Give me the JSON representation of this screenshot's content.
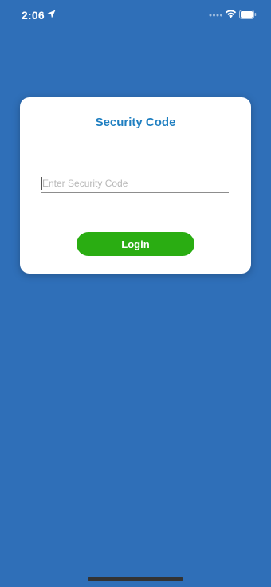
{
  "status_bar": {
    "time": "2:06"
  },
  "card": {
    "title": "Security Code",
    "input": {
      "value": "",
      "placeholder": "Enter Security Code"
    },
    "login_label": "Login"
  },
  "colors": {
    "background": "#2f6fb8",
    "title": "#1f7fc1",
    "login_button": "#2aad12"
  }
}
